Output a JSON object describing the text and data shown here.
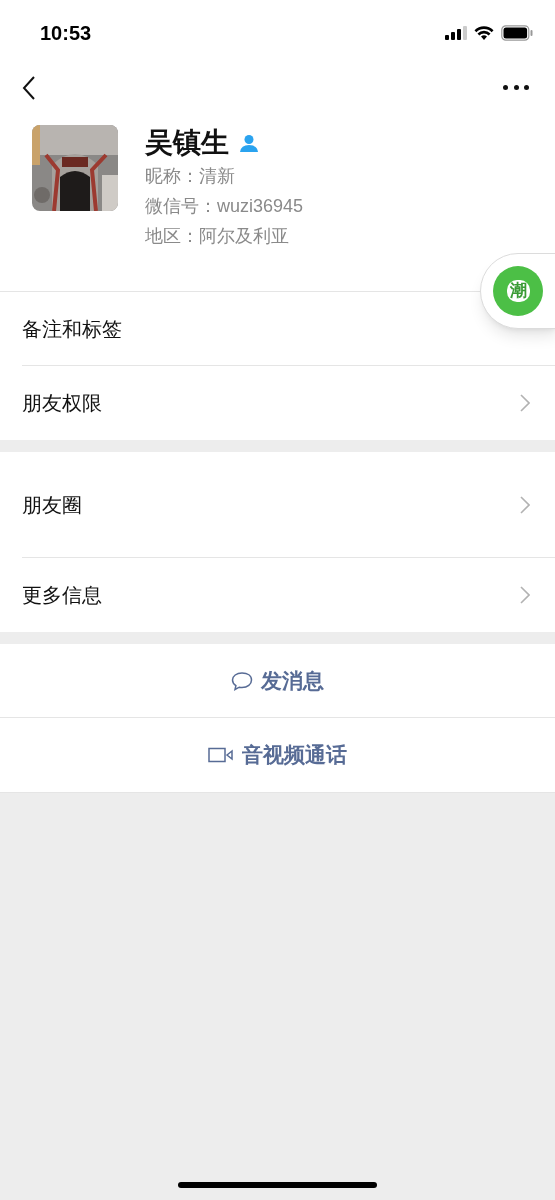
{
  "status_bar": {
    "time": "10:53"
  },
  "profile": {
    "name": "吴镇生",
    "nickname": "昵称：清新",
    "wechat_id": "微信号：wuzi36945",
    "region": "地区：阿尔及利亚"
  },
  "floating_bubble": {
    "label": "潮"
  },
  "sections": [
    {
      "rows": [
        {
          "label": "备注和标签",
          "tall": false,
          "chevron": false
        },
        {
          "label": "朋友权限",
          "tall": false,
          "chevron": true
        }
      ]
    },
    {
      "rows": [
        {
          "label": "朋友圈",
          "tall": true,
          "chevron": true
        },
        {
          "label": "更多信息",
          "tall": false,
          "chevron": true
        }
      ]
    }
  ],
  "actions": [
    {
      "kind": "message",
      "label": "发消息"
    },
    {
      "kind": "video",
      "label": "音视频通话"
    }
  ]
}
